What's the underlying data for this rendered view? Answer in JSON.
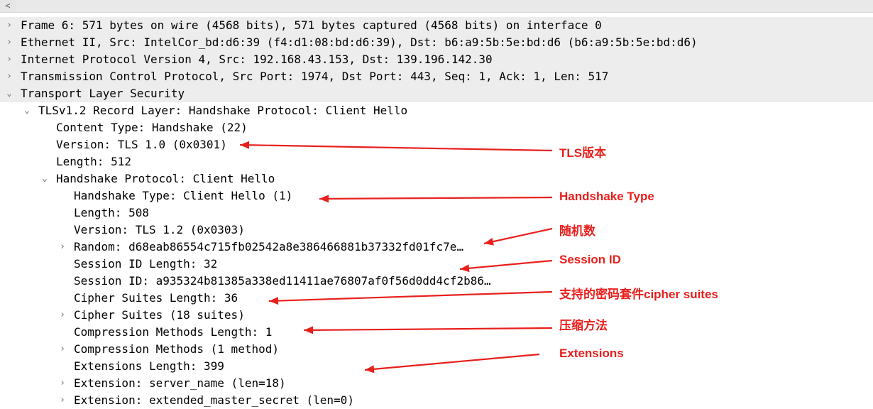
{
  "colors": {
    "annotation": "#e8201d",
    "row_shade": "#ededed",
    "expander": "#707070"
  },
  "icons": {
    "collapsed": "chevron-right-icon",
    "expanded": "chevron-down-icon"
  },
  "tree": [
    {
      "text": "Frame 6: 571 bytes on wire (4568 bits), 571 bytes captured (4568 bits) on interface 0",
      "level": 0,
      "toggle": "›",
      "shaded": true
    },
    {
      "text": "Ethernet II, Src: IntelCor_bd:d6:39 (f4:d1:08:bd:d6:39), Dst: b6:a9:5b:5e:bd:d6 (b6:a9:5b:5e:bd:d6)",
      "level": 0,
      "toggle": "›",
      "shaded": true
    },
    {
      "text": "Internet Protocol Version 4, Src: 192.168.43.153, Dst: 139.196.142.30",
      "level": 0,
      "toggle": "›",
      "shaded": true
    },
    {
      "text": "Transmission Control Protocol, Src Port: 1974, Dst Port: 443, Seq: 1, Ack: 1, Len: 517",
      "level": 0,
      "toggle": "›",
      "shaded": true
    },
    {
      "text": "Transport Layer Security",
      "level": 0,
      "toggle": "⌄",
      "shaded": true
    },
    {
      "text": "TLSv1.2 Record Layer: Handshake Protocol: Client Hello",
      "level": 1,
      "toggle": "⌄",
      "shaded": false
    },
    {
      "text": "Content Type: Handshake (22)",
      "level": 2,
      "toggle": "",
      "shaded": false
    },
    {
      "text": "Version: TLS 1.0 (0x0301)",
      "level": 2,
      "toggle": "",
      "shaded": false
    },
    {
      "text": "Length: 512",
      "level": 2,
      "toggle": "",
      "shaded": false
    },
    {
      "text": "Handshake Protocol: Client Hello",
      "level": 2,
      "toggle": "⌄",
      "shaded": false
    },
    {
      "text": "Handshake Type: Client Hello (1)",
      "level": 3,
      "toggle": "",
      "shaded": false
    },
    {
      "text": "Length: 508",
      "level": 3,
      "toggle": "",
      "shaded": false
    },
    {
      "text": "Version: TLS 1.2 (0x0303)",
      "level": 3,
      "toggle": "",
      "shaded": false
    },
    {
      "text": "Random: d68eab86554c715fb02542a8e386466881b37332fd01fc7e…",
      "level": 3,
      "toggle": "›",
      "shaded": false
    },
    {
      "text": "Session ID Length: 32",
      "level": 3,
      "toggle": "",
      "shaded": false
    },
    {
      "text": "Session ID: a935324b81385a338ed11411ae76807af0f56d0dd4cf2b86…",
      "level": 3,
      "toggle": "",
      "shaded": false
    },
    {
      "text": "Cipher Suites Length: 36",
      "level": 3,
      "toggle": "",
      "shaded": false
    },
    {
      "text": "Cipher Suites (18 suites)",
      "level": 3,
      "toggle": "›",
      "shaded": false
    },
    {
      "text": "Compression Methods Length: 1",
      "level": 3,
      "toggle": "",
      "shaded": false
    },
    {
      "text": "Compression Methods (1 method)",
      "level": 3,
      "toggle": "›",
      "shaded": false
    },
    {
      "text": "Extensions Length: 399",
      "level": 3,
      "toggle": "",
      "shaded": false
    },
    {
      "text": "Extension: server_name (len=18)",
      "level": 3,
      "toggle": "›",
      "shaded": false
    },
    {
      "text": "Extension: extended_master_secret (len=0)",
      "level": 3,
      "toggle": "›",
      "shaded": false
    }
  ],
  "annotations": [
    {
      "text": "TLS版本"
    },
    {
      "text": "Handshake Type"
    },
    {
      "text": "随机数"
    },
    {
      "text": "Session ID"
    },
    {
      "text": "支持的密码套件cipher suites"
    },
    {
      "text": "压缩方法"
    },
    {
      "text": "Extensions"
    }
  ]
}
